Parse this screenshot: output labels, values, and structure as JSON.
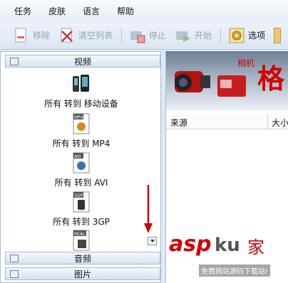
{
  "menu": [
    "任务",
    "皮肤",
    "语言",
    "帮助"
  ],
  "toolbar": {
    "remove": "移除",
    "clear_list": "清空列表",
    "stop": "停止",
    "start": "开始",
    "options": "选项"
  },
  "left": {
    "video_header": "视频",
    "items": [
      {
        "label": "所有 转到 移动设备",
        "badge": ""
      },
      {
        "label": "所有 转到 MP4",
        "badge": "MP4"
      },
      {
        "label": "所有 转到 AVI",
        "badge": "AVI"
      },
      {
        "label": "所有 转到 3GP",
        "badge": "3GP"
      },
      {
        "label": "",
        "badge": "REAL"
      }
    ],
    "audio_header": "音频",
    "image_header": "图片"
  },
  "right": {
    "banner_small": "相机",
    "banner_big": "格",
    "col_source": "来源",
    "col_size": "大小",
    "wm_logo_a": "asp",
    "wm_logo_b": "ku",
    "wm_logo_c": "家",
    "wm_tagline": "免费网站源码下载站!"
  },
  "colors": {
    "accent_red": "#d40000",
    "header_blue": "#d7e3f1"
  }
}
